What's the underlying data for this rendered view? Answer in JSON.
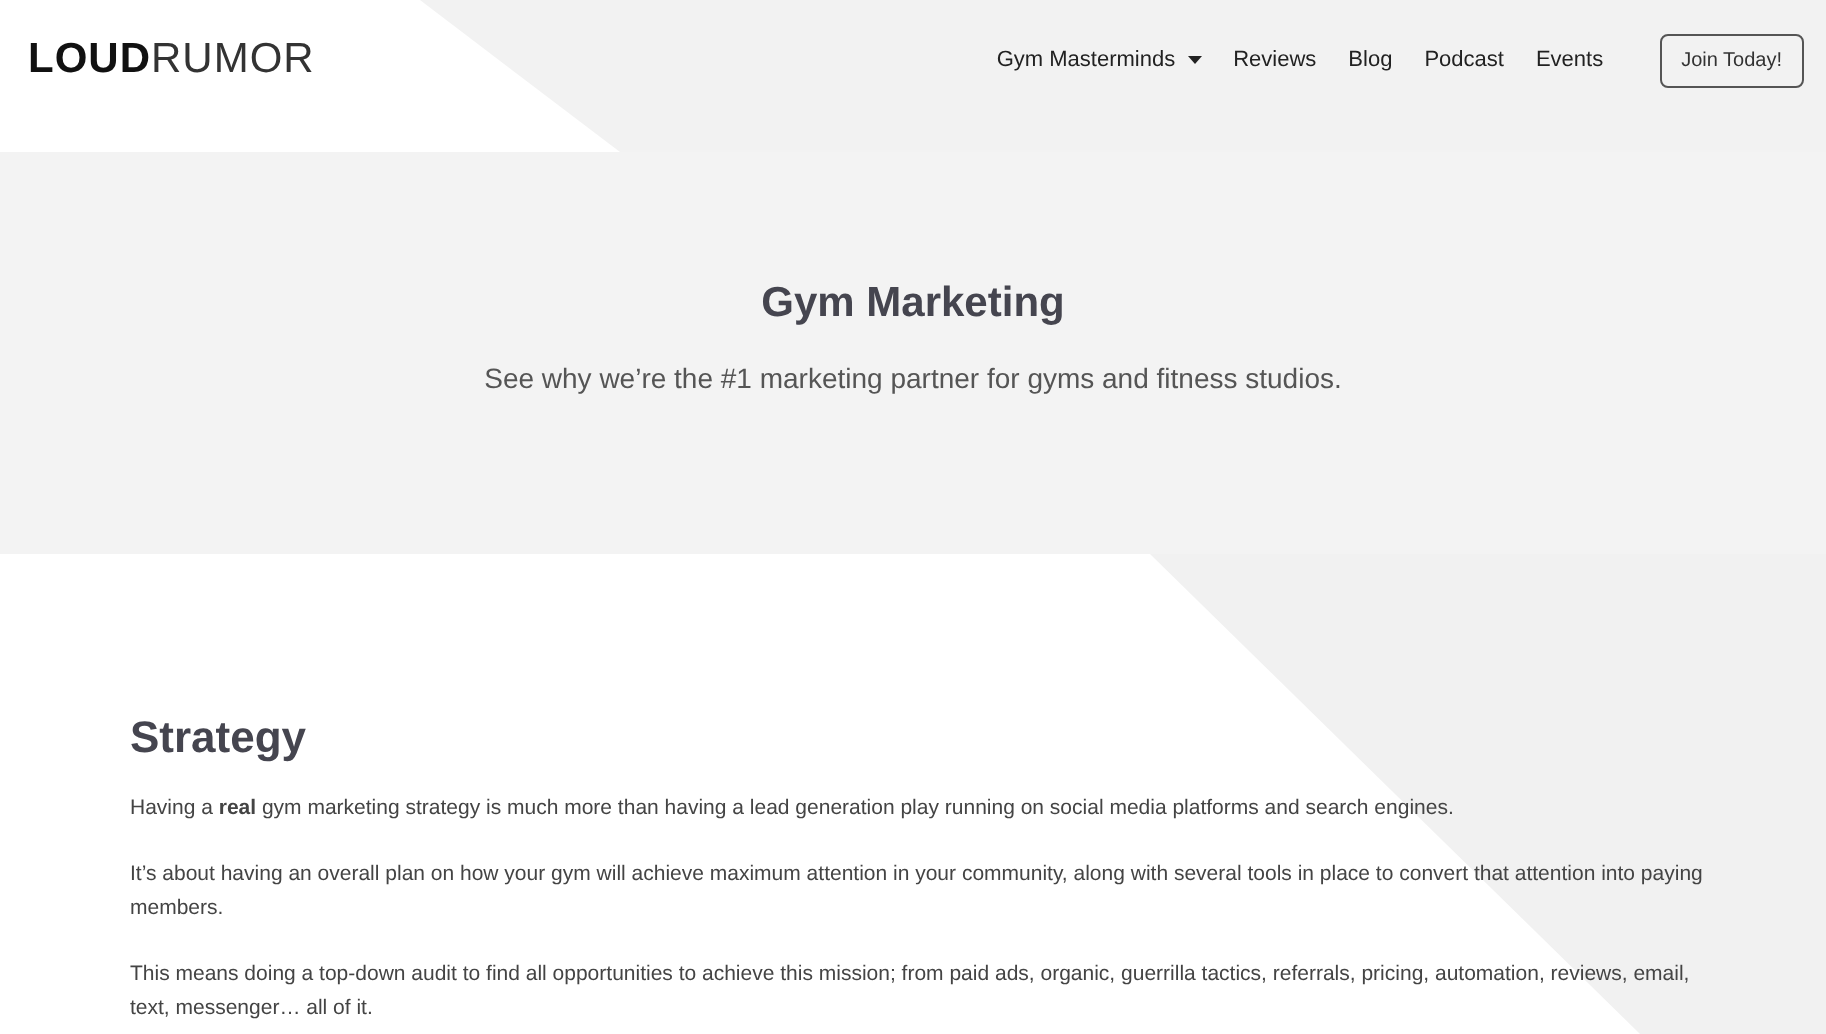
{
  "header": {
    "logo": {
      "bold": "LOUD",
      "light": "RUMOR"
    },
    "nav": [
      {
        "label": "Gym Masterminds",
        "has_dropdown": true
      },
      {
        "label": "Reviews",
        "has_dropdown": false
      },
      {
        "label": "Blog",
        "has_dropdown": false
      },
      {
        "label": "Podcast",
        "has_dropdown": false
      },
      {
        "label": "Events",
        "has_dropdown": false
      }
    ],
    "cta": "Join Today!"
  },
  "hero": {
    "title": "Gym Marketing",
    "subtitle": "See why we’re the #1 marketing partner for gyms and fitness studios."
  },
  "section": {
    "heading": "Strategy",
    "paragraphs": [
      "Having a **real** gym marketing strategy is much more than having a lead generation play running on social media platforms and search engines.",
      "It’s about having an overall plan on how your gym will achieve maximum attention in your community, along with several tools in place to convert that attention into paying members.",
      "This means doing a top-down audit to find all opportunities to achieve this mission; from paid ads, organic, guerrilla tactics, referrals, pricing, automation, reviews, email, text, messenger… all of it."
    ]
  }
}
